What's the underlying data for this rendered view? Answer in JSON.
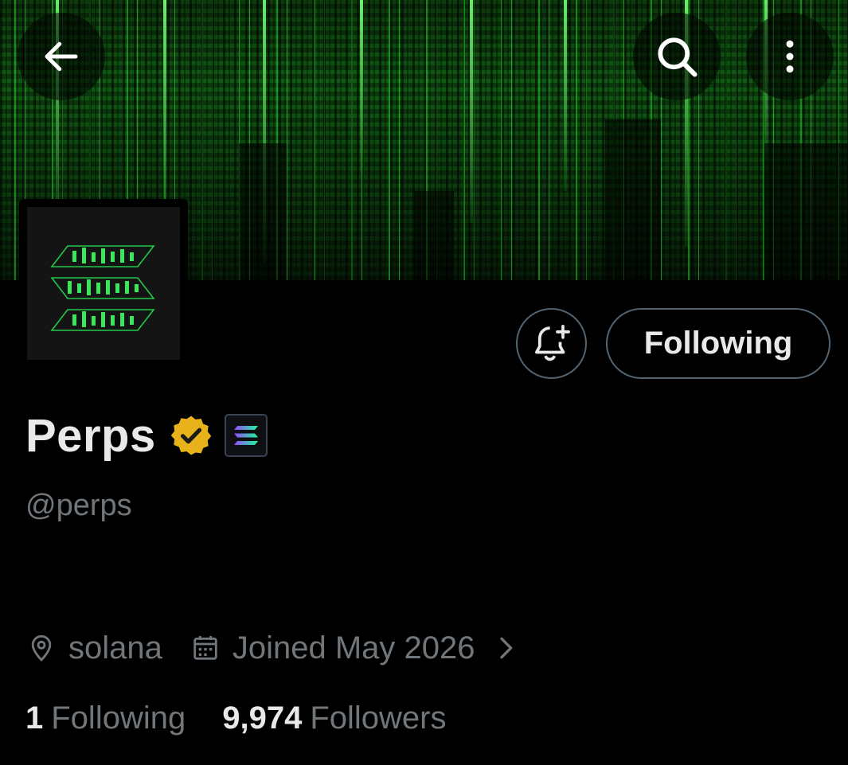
{
  "header": {
    "back_icon": "arrow-left-icon",
    "search_icon": "search-icon",
    "more_icon": "more-vertical-icon"
  },
  "profile": {
    "display_name": "Perps",
    "handle": "@perps",
    "verified_badge": "verified-gold-icon",
    "affiliate_badge": "solana-logo-icon"
  },
  "actions": {
    "notify_icon": "bell-plus-icon",
    "following_label": "Following"
  },
  "meta": {
    "location": "solana",
    "joined": "Joined May 2026"
  },
  "stats": {
    "following_count": "1",
    "following_label": "Following",
    "followers_count": "9,974",
    "followers_label": "Followers"
  },
  "colors": {
    "background": "#000000",
    "primary_text": "#e7e9ea",
    "secondary_text": "#71767b",
    "border": "#536471",
    "accent_green": "#22c84a",
    "verified_gold": "#e8b31a"
  }
}
